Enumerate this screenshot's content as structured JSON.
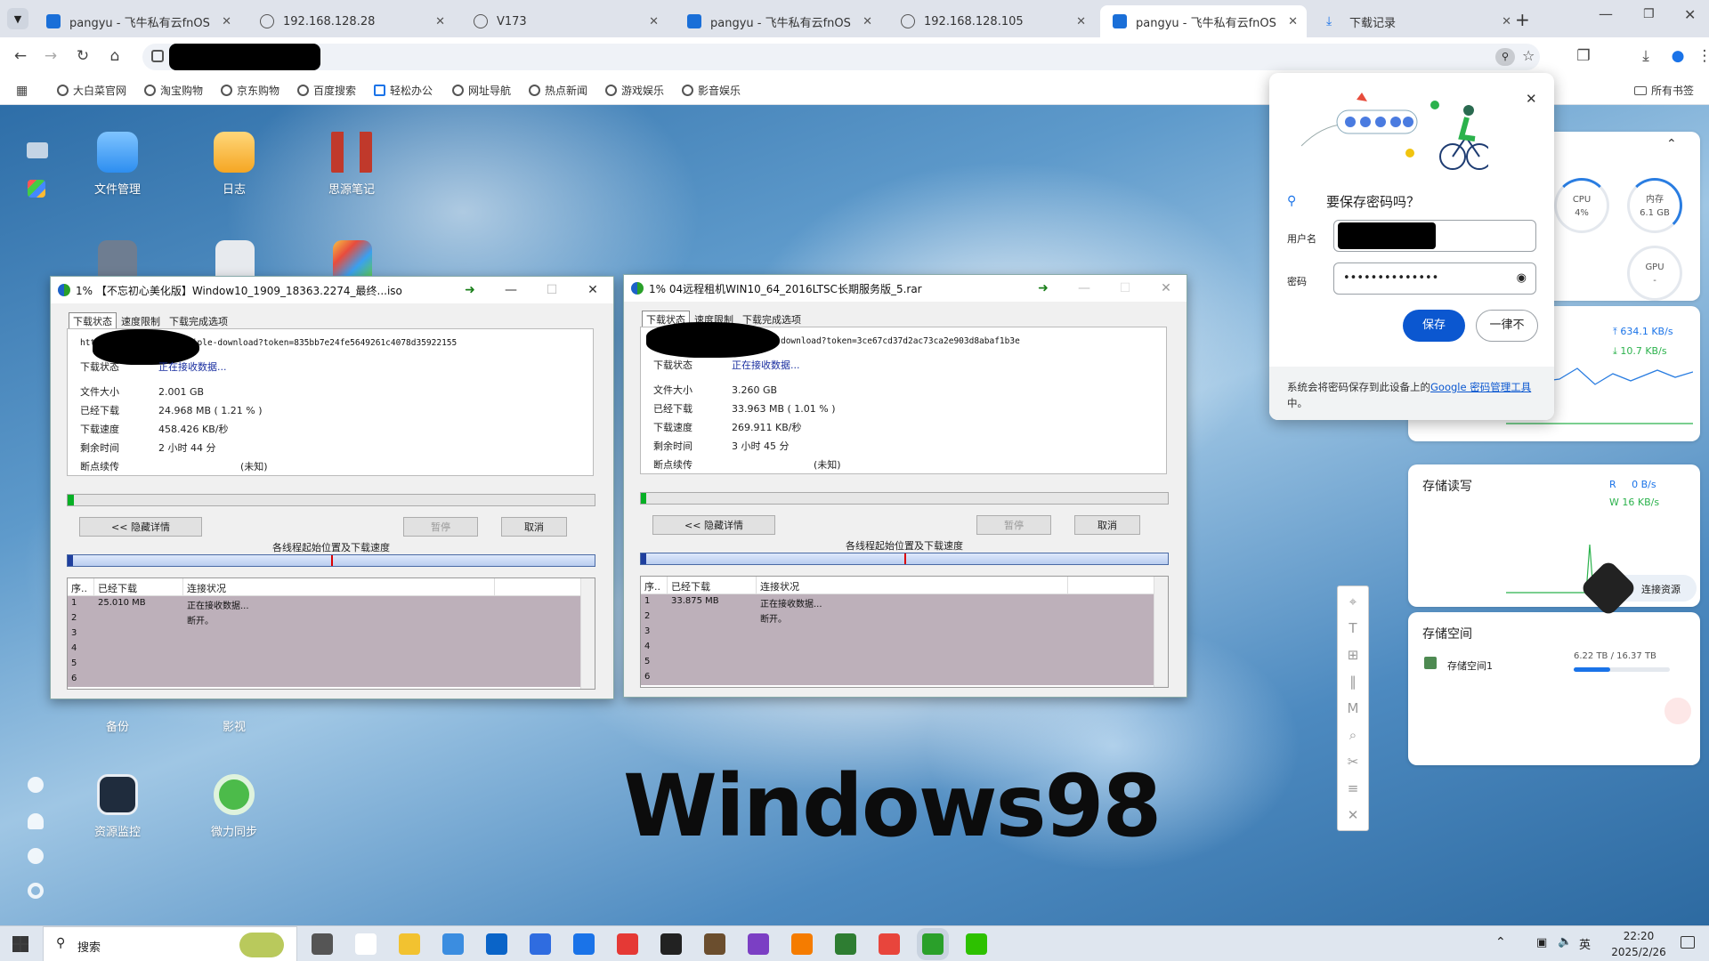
{
  "browser": {
    "tabs": [
      {
        "title": "pangyu - 飞牛私有云fnOS",
        "icon": "fnos-icon",
        "active": false
      },
      {
        "title": "192.168.128.28",
        "icon": "globe-icon",
        "active": false
      },
      {
        "title": "V173",
        "icon": "globe-icon",
        "active": false
      },
      {
        "title": "pangyu - 飞牛私有云fnOS",
        "icon": "fnos-icon",
        "active": false
      },
      {
        "title": "192.168.128.105",
        "icon": "globe-icon",
        "active": false
      },
      {
        "title": "pangyu - 飞牛私有云fnOS",
        "icon": "fnos-icon",
        "active": true
      },
      {
        "title": "下载记录",
        "icon": "download-icon",
        "active": false
      }
    ],
    "bookmarks": [
      "大白菜官网",
      "淘宝购物",
      "京东购物",
      "百度搜索",
      "轻松办公",
      "网址导航",
      "热点新闻",
      "游戏娱乐",
      "影音娱乐"
    ],
    "all_bookmarks": "所有书签"
  },
  "desktop": {
    "icons": [
      "文件管理",
      "日志",
      "思源笔记",
      "备份",
      "影视",
      "资源监控",
      "微力同步"
    ],
    "wallpaper_text": "Windows98"
  },
  "dialog1": {
    "title": "1%  【不忘初心美化版】Window10_1909_18363.2274_最终...iso",
    "tabs": [
      "下载状态",
      "速度限制",
      "下载完成选项"
    ],
    "url": "htt▮▮▮▮▮▮▮▮▮▮▮▮02/multiple-download?token=835bb7e24fe5649261c4078d35922155",
    "status_label": "下载状态",
    "status_value": "正在接收数据...",
    "size_label": "文件大小",
    "size_value": "2.001  GB",
    "done_label": "已经下载",
    "done_value": "24.968  MB  ( 1.21 % )",
    "speed_label": "下载速度",
    "speed_value": "458.426  KB/秒",
    "remain_label": "剩余时间",
    "remain_value": "2 小时 44 分",
    "resume_label": "断点续传",
    "resume_value": "(未知)",
    "progress": 0.0121,
    "btn_hide": "<< 隐藏详情",
    "btn_pause": "暂停",
    "btn_cancel": "取消",
    "threads_label": "各线程起始位置及下载速度",
    "cols": [
      "序..",
      "已经下载",
      "连接状况"
    ],
    "rows": [
      [
        "1",
        "25.010 MB",
        "正在接收数据..."
      ],
      [
        "2",
        "",
        "断开。"
      ],
      [
        "3",
        "",
        ""
      ],
      [
        "4",
        "",
        ""
      ],
      [
        "5",
        "",
        ""
      ],
      [
        "6",
        "",
        ""
      ]
    ]
  },
  "dialog2": {
    "title": "1%  04远程租机WIN10_64_2016LTSC长期服务版_5.rar",
    "tabs": [
      "下载状态",
      "速度限制",
      "下载完成选项"
    ],
    "url": "▮▮▮▮▮▮▮▮▮▮▮▮▮▮▮▮multiple-download?token=3ce67cd37d2ac73ca2e903d8abaf1b3e",
    "status_label": "下载状态",
    "status_value": "正在接收数据...",
    "size_label": "文件大小",
    "size_value": "3.260  GB",
    "done_label": "已经下载",
    "done_value": "33.963  MB  ( 1.01 % )",
    "speed_label": "下载速度",
    "speed_value": "269.911  KB/秒",
    "remain_label": "剩余时间",
    "remain_value": "3 小时 45 分",
    "resume_label": "断点续传",
    "resume_value": "(未知)",
    "progress": 0.0101,
    "btn_hide": "<< 隐藏详情",
    "btn_pause": "暂停",
    "btn_cancel": "取消",
    "threads_label": "各线程起始位置及下载速度",
    "cols": [
      "序..",
      "已经下载",
      "连接状况"
    ],
    "rows": [
      [
        "1",
        "33.875 MB",
        "正在接收数据..."
      ],
      [
        "2",
        "",
        "断开。"
      ],
      [
        "3",
        "",
        ""
      ],
      [
        "4",
        "",
        ""
      ],
      [
        "5",
        "",
        ""
      ],
      [
        "6",
        "",
        ""
      ]
    ]
  },
  "password_popup": {
    "title": "要保存密码吗？",
    "user_label": "用户名",
    "pass_label": "密码",
    "pass_value": "••••••••••••••",
    "save": "保存",
    "never": "一律不",
    "footer_pre": "系统会将密码保存到此设备上的",
    "footer_link": "Google 密码管理工具",
    "footer_post": "中。"
  },
  "widgets": {
    "cpu_label": "CPU",
    "cpu_value": "4%",
    "cpu_level": 0.04,
    "mem_label": "内存",
    "mem_value": "6.1 GB",
    "gpu_label": "GPU",
    "gpu_value": "-",
    "net_up": "634.1 KB/s",
    "net_down": "10.7 KB/s",
    "storage_rw_title": "存储读写",
    "read_label": "R",
    "read_value": "0 B/s",
    "write_label": "W",
    "write_value": "16 KB/s",
    "connect_label": "连接资源",
    "storage_title": "存储空间",
    "storage_name": "存储空间1",
    "storage_usage": "6.22 TB / 16.37 TB",
    "storage_level": 0.38
  },
  "taskbar": {
    "search": "搜索",
    "time": "22:20",
    "date": "2025/2/26",
    "ime": "英"
  },
  "colors": {
    "accent": "#1a73e8",
    "progress": "#06b025",
    "tab_bar": "#dfe3eb"
  }
}
